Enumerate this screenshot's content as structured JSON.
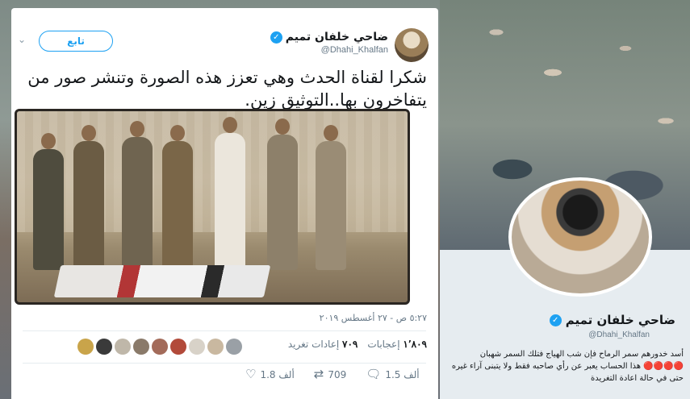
{
  "tweet": {
    "author_name": "ضاحي خلفان تميم",
    "author_handle": "@Dhahi_Khalfan",
    "follow_label": "تابع",
    "text": "شكرا لقناة الحدث وهي تعزز هذه الصورة وتنشر صور من يتفاخرون بها..التوثيق زين.",
    "timestamp": "٥:٢٧ ص - ٢٧ أغسطس ٢٠١٩",
    "retweets_count": "٧٠٩",
    "retweets_label": "إعادات تغريد",
    "likes_count": "١٬٨٠٩",
    "likes_label": "إعجابات",
    "reply_count": "1.5 ألف",
    "retweet_action_count": "709",
    "like_action_count": "1.8 ألف"
  },
  "profile": {
    "name": "ضاحي خلفان تميم",
    "handle": "@Dhahi_Khalfan",
    "bio": "أسد خدورهم سمر الرماح فإن شب الهياج فتلك السمر شهبان 🔴🔴🔴🔴 هذا الحساب يعبر عن رأي صاحبه فقط ولا يتبنى آراء غيره حتى في حالة اعادة التغريدة"
  },
  "icons": {
    "verified": "verified-badge-icon",
    "chevron": "chevron-down-icon",
    "reply": "reply-icon",
    "retweet": "retweet-icon",
    "like": "heart-icon"
  },
  "colors": {
    "accent": "#1da1f2",
    "text": "#14171a",
    "muted": "#657786"
  }
}
